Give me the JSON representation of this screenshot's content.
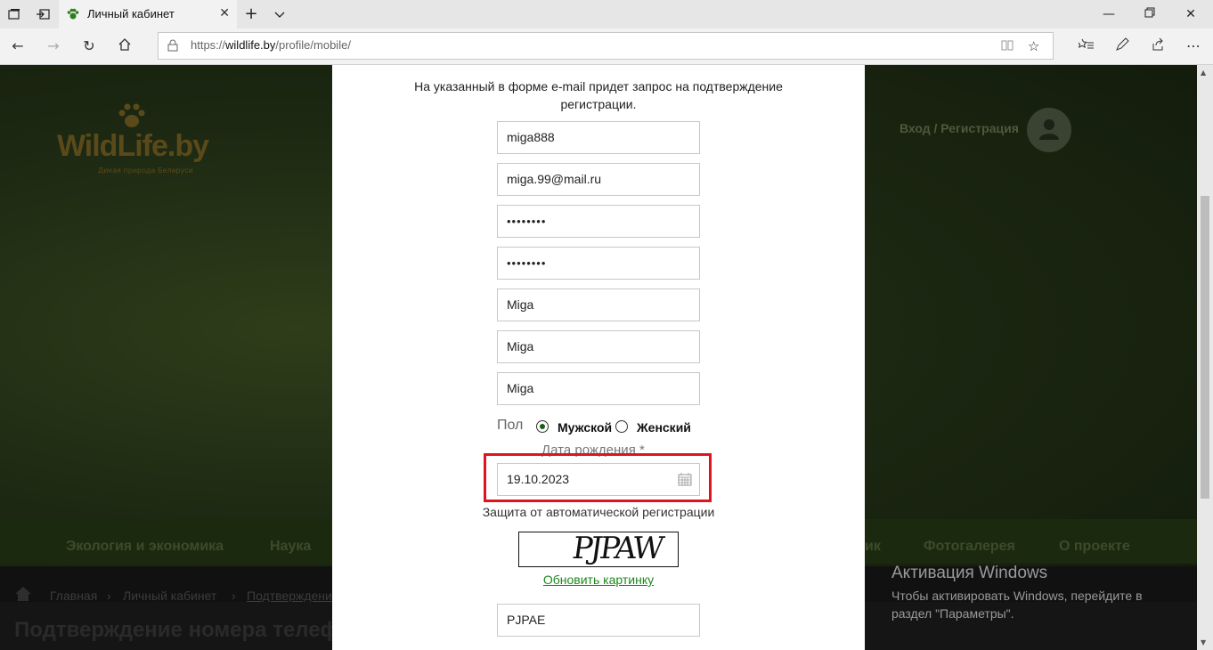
{
  "browser": {
    "tab_title": "Личный кабинет",
    "url_prefix": "https://",
    "url_domain": "wildlife.by",
    "url_path": "/profile/mobile/"
  },
  "site": {
    "logo_text": "WildLife.by",
    "logo_sub": "Дикая природа Беларуси",
    "login_link": "Вход / Регистрация",
    "menu": [
      "Экология и экономика",
      "Наука",
      "ик",
      "Фотогалерея",
      "О проекте"
    ],
    "breadcrumbs": [
      "Главная",
      "Личный кабинет",
      "Подтверждени"
    ],
    "page_title": "Подтверждение номера телефо"
  },
  "modal": {
    "intro": "На указанный в форме e-mail придет запрос на подтверждение регистрации.",
    "fields": {
      "login": "miga888",
      "email": "miga.99@mail.ru",
      "password": "••••••••",
      "password_confirm": "••••••••",
      "name1": "Miga",
      "name2": "Miga",
      "name3": "Miga"
    },
    "gender_label": "Пол",
    "gender_male": "Мужской",
    "gender_female": "Женский",
    "gender_selected": "Мужской",
    "dob_label": "Дата рождения *",
    "dob_value": "19.10.2023",
    "captcha_label": "Защита от автоматической регистрации",
    "captcha_image_text": "PJPAW",
    "refresh_link": "Обновить картинку",
    "captcha_value": "PJPAE"
  },
  "windows_activation": {
    "title": "Активация Windows",
    "text": "Чтобы активировать Windows, перейдите в раздел \"Параметры\"."
  },
  "colors": {
    "highlight": "#e0141e",
    "link": "#1a8a1a",
    "radio_selected": "#1a5c1a"
  }
}
